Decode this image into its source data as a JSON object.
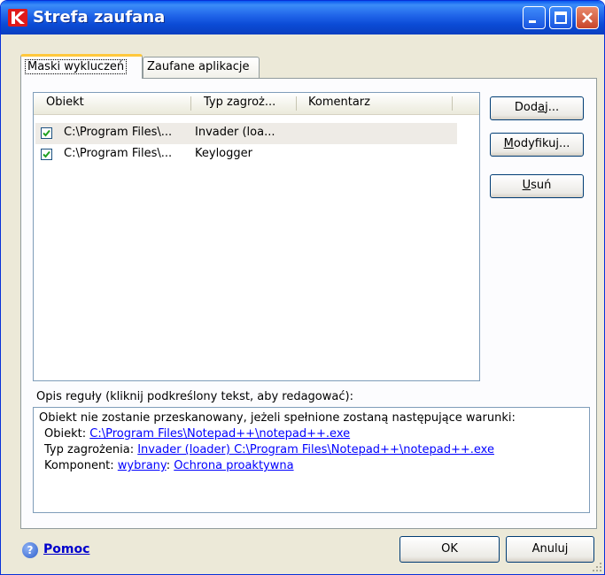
{
  "window": {
    "title": "Strefa zaufana"
  },
  "tabs": [
    {
      "label": "Maski wykluczeń",
      "active": true
    },
    {
      "label": "Zaufane aplikacje",
      "active": false
    }
  ],
  "list": {
    "columns": [
      "Obiekt",
      "Typ zagroż...",
      "Komentarz"
    ],
    "rows": [
      {
        "checked": true,
        "obiekt": "C:\\Program Files\\...",
        "typ": "Invader (loa...",
        "komentarz": "",
        "selected": true
      },
      {
        "checked": true,
        "obiekt": "C:\\Program Files\\...",
        "typ": "Keylogger",
        "komentarz": "",
        "selected": false
      }
    ]
  },
  "side_buttons": {
    "add": {
      "label": "Dodaj...",
      "mnemonic_index": 3
    },
    "modify": {
      "label": "Modyfikuj...",
      "mnemonic_index": 0
    },
    "remove": {
      "label": "Usuń",
      "mnemonic_index": 0
    }
  },
  "description": {
    "label": "Opis reguły (kliknij podkreślony tekst, aby redagować):",
    "intro": "Obiekt nie zostanie przeskanowany, jeżeli spełnione zostaną następujące warunki:",
    "obiekt_label": "Obiekt:",
    "obiekt_value": "C:\\Program Files\\Notepad++\\notepad++.exe",
    "typ_label": "Typ zagrożenia:",
    "typ_value": "Invader (loader) C:\\Program Files\\Notepad++\\notepad++.exe",
    "komponent_label": "Komponent:",
    "komponent_value1": "wybrany",
    "komponent_sep": ":",
    "komponent_value2": "Ochrona proaktywna"
  },
  "footer": {
    "help": "Pomoc",
    "ok": "OK",
    "cancel": "Anuluj"
  },
  "colors": {
    "titlebar": "#0B4BD6",
    "dialog_bg": "#ECE9D8",
    "link": "#0000FF",
    "active_tab_accent": "#FFC83C"
  }
}
